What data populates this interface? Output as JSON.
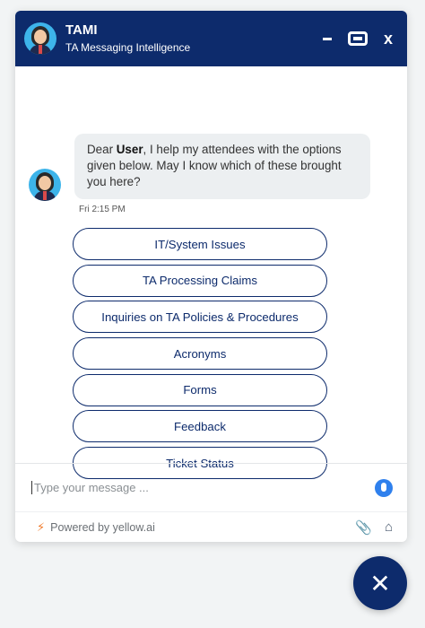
{
  "header": {
    "title": "TAMI",
    "subtitle": "TA Messaging Intelligence",
    "minimize_icon": "minimize-icon",
    "maximize_icon": "maximize-icon",
    "close_label": "x"
  },
  "message": {
    "prefix": "Dear ",
    "user": "User",
    "suffix": ", I help my attendees with the options given below. May I know which of these brought you here?",
    "time": "Fri 2:15 PM"
  },
  "options": [
    "IT/System Issues",
    "TA Processing Claims",
    "Inquiries on TA Policies & Procedures",
    "Acronyms",
    "Forms",
    "Feedback",
    "Ticket Status"
  ],
  "input": {
    "placeholder": "Type your message ...",
    "value": ""
  },
  "footer": {
    "powered_by": "Powered by yellow.ai"
  },
  "fab": {
    "label": "✕"
  },
  "colors": {
    "brand": "#0d2b6c",
    "bubble": "#eceff1",
    "avatar_bg": "#3db4ea",
    "mic": "#2f80ed",
    "bolt": "#f07b2b"
  }
}
